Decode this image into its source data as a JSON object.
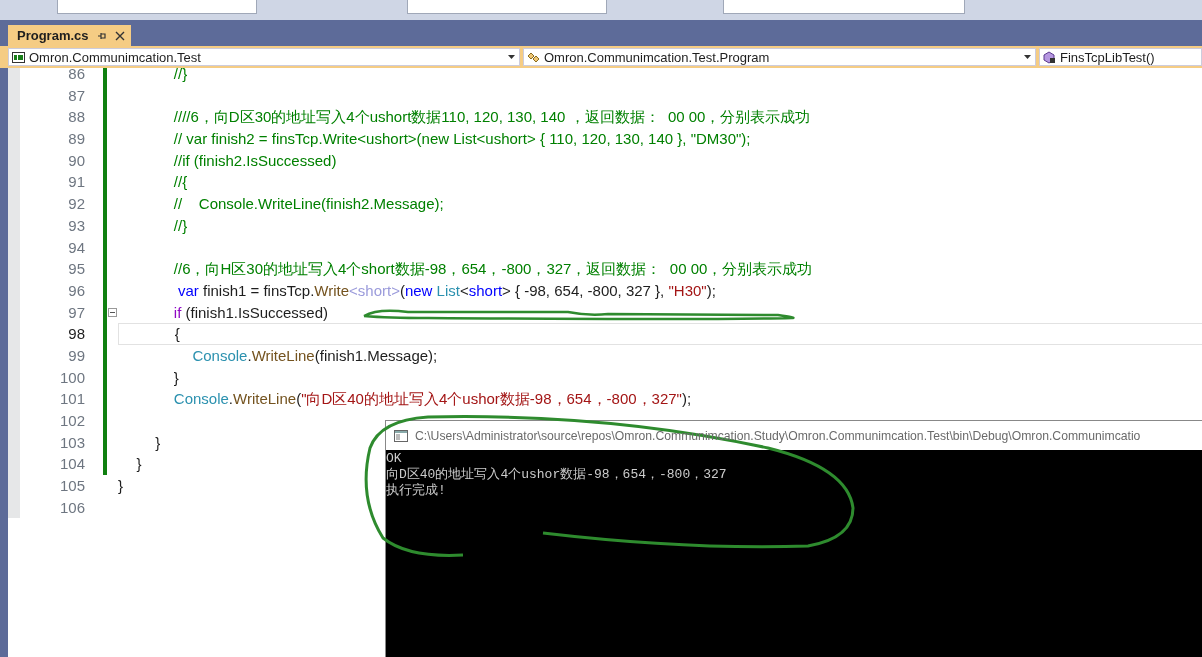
{
  "tab": {
    "title": "Program.cs",
    "selected": true
  },
  "navigation": [
    {
      "label": "Omron.Communimcation.Test"
    },
    {
      "label": "Omron.Communimcation.Test.Program"
    },
    {
      "label": "FinsTcpLibTest()"
    }
  ],
  "code_lines": [
    {
      "number": "86",
      "changed": true,
      "current": false,
      "collapsible": false,
      "tokens": [
        {
          "kind": "comment",
          "text": "\t\t\t//}"
        }
      ]
    },
    {
      "number": "87",
      "changed": true,
      "current": false,
      "collapsible": false
    },
    {
      "number": "88",
      "changed": true,
      "current": false,
      "collapsible": false,
      "tokens": [
        {
          "kind": "comment",
          "text": "\t\t\t////6，向D区30的地址写入4个ushort数据110, 120, 130, 140 ，返回数据：  00 00，分别表示成功"
        }
      ]
    },
    {
      "number": "89",
      "changed": true,
      "current": false,
      "collapsible": false,
      "tokens": [
        {
          "kind": "comment",
          "text": "\t\t\t// var finish2 = finsTcp.Write<ushort>(new List<ushort> { 110, 120, 130, 140 }, \"DM30\");"
        }
      ]
    },
    {
      "number": "90",
      "changed": true,
      "current": false,
      "collapsible": false,
      "tokens": [
        {
          "kind": "comment",
          "text": "\t\t\t//if (finish2.IsSuccessed)"
        }
      ]
    },
    {
      "number": "91",
      "changed": true,
      "current": false,
      "collapsible": false,
      "tokens": [
        {
          "kind": "comment",
          "text": "\t\t\t//{"
        }
      ]
    },
    {
      "number": "92",
      "changed": true,
      "current": false,
      "collapsible": false,
      "tokens": [
        {
          "kind": "comment",
          "text": "\t\t\t//    Console.WriteLine(finish2.Message);"
        }
      ]
    },
    {
      "number": "93",
      "changed": true,
      "current": false,
      "collapsible": false,
      "tokens": [
        {
          "kind": "comment",
          "text": "\t\t\t//}"
        }
      ]
    },
    {
      "number": "94",
      "changed": true,
      "current": false,
      "collapsible": false
    },
    {
      "number": "95",
      "changed": true,
      "current": false,
      "collapsible": false,
      "tokens": [
        {
          "kind": "comment",
          "text": "\t\t\t//6，向H区30的地址写入4个short数据-98，654，-800，327，返回数据：  00 00，分别表示成功"
        }
      ]
    },
    {
      "number": "96",
      "changed": true,
      "current": false,
      "collapsible": false,
      "tokens": [
        {
          "kind": "keyword",
          "text": "\t\t\t var"
        },
        {
          "kind": "plain",
          "text": " finish1 = finsTcp."
        },
        {
          "kind": "method",
          "text": "Write"
        },
        {
          "kind": "inferred",
          "text": "<short>"
        },
        {
          "kind": "plain",
          "text": "("
        },
        {
          "kind": "keyword",
          "text": "new "
        },
        {
          "kind": "type",
          "text": "List"
        },
        {
          "kind": "plain",
          "text": "<"
        },
        {
          "kind": "keyword",
          "text": "short"
        },
        {
          "kind": "plain",
          "text": "> { -98, 654, -800, 327 }, "
        },
        {
          "kind": "string",
          "text": "\"H30\""
        },
        {
          "kind": "plain",
          "text": ");"
        }
      ]
    },
    {
      "number": "97",
      "changed": true,
      "current": false,
      "collapsible": true,
      "tokens": [
        {
          "kind": "control",
          "text": "\t\t\tif"
        },
        {
          "kind": "plain",
          "text": " (finish1.IsSuccessed)"
        }
      ]
    },
    {
      "number": "98",
      "changed": true,
      "current": true,
      "collapsible": false,
      "tokens": [
        {
          "kind": "plain",
          "text": "\t\t\t{"
        }
      ]
    },
    {
      "number": "99",
      "changed": true,
      "current": false,
      "collapsible": false,
      "tokens": [
        {
          "kind": "type",
          "text": "\t\t\t\tConsole"
        },
        {
          "kind": "plain",
          "text": "."
        },
        {
          "kind": "method",
          "text": "WriteLine"
        },
        {
          "kind": "plain",
          "text": "(finish1.Message);"
        }
      ]
    },
    {
      "number": "100",
      "changed": true,
      "current": false,
      "collapsible": false,
      "tokens": [
        {
          "kind": "plain",
          "text": "\t\t\t}"
        }
      ]
    },
    {
      "number": "101",
      "changed": true,
      "current": false,
      "collapsible": false,
      "tokens": [
        {
          "kind": "type",
          "text": "\t\t\tConsole"
        },
        {
          "kind": "plain",
          "text": "."
        },
        {
          "kind": "method",
          "text": "WriteLine"
        },
        {
          "kind": "plain",
          "text": "("
        },
        {
          "kind": "string",
          "text": "\"向D区40的地址写入4个ushor数据-98，654，-800，327\""
        },
        {
          "kind": "plain",
          "text": ");"
        }
      ]
    },
    {
      "number": "102",
      "changed": true,
      "current": false,
      "collapsible": false
    },
    {
      "number": "103",
      "changed": true,
      "current": false,
      "collapsible": false,
      "tokens": [
        {
          "kind": "plain",
          "text": "\t\t}"
        }
      ]
    },
    {
      "number": "104",
      "changed": true,
      "current": false,
      "collapsible": false,
      "tokens": [
        {
          "kind": "plain",
          "text": "\t}"
        }
      ]
    },
    {
      "number": "105",
      "changed": false,
      "current": false,
      "collapsible": false,
      "tokens": [
        {
          "kind": "plain",
          "text": "}"
        }
      ]
    },
    {
      "number": "106",
      "changed": false,
      "current": false,
      "collapsible": false
    }
  ],
  "console": {
    "title": "C:\\Users\\Administrator\\source\\repos\\Omron.Communimcation.Study\\Omron.Communimcation.Test\\bin\\Debug\\Omron.Communimcatio",
    "lines": [
      "OK",
      "向D区40的地址写入4个ushor数据-98，654，-800，327",
      "执行完成!"
    ]
  }
}
